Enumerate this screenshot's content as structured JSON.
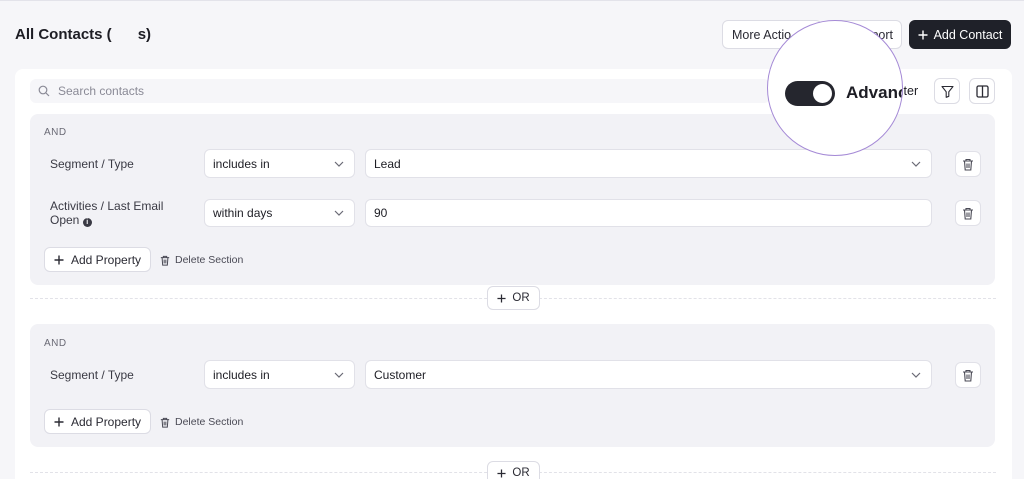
{
  "header": {
    "title": "All Contacts (",
    "title_suffix": "s)",
    "more_actions_label": "More Actio",
    "import_label": "port",
    "add_contact_label": "Add Contact"
  },
  "toolbar": {
    "search_placeholder": "Search contacts",
    "advanced_filter_label": "ilter",
    "advanced_filter_zoom_label": "Advanc",
    "advanced_filter_enabled": true
  },
  "sections": [
    {
      "and_label": "AND",
      "rows": [
        {
          "property": "Segment  /  Type",
          "operator": "includes in",
          "value": "Lead"
        },
        {
          "property_line1": "Activities  /  Last Email",
          "property_line2": "Open",
          "operator": "within days",
          "value": "90"
        }
      ],
      "add_property_label": "Add Property",
      "delete_section_label": "Delete Section"
    },
    {
      "and_label": "AND",
      "rows": [
        {
          "property": "Segment  /  Type",
          "operator": "includes in",
          "value": "Customer"
        }
      ],
      "add_property_label": "Add Property",
      "delete_section_label": "Delete Section"
    }
  ],
  "or_label": "OR",
  "colors": {
    "background": "#f6f6f9",
    "primary_button": "#1f2129",
    "magnifier_border": "#a58ad6"
  }
}
